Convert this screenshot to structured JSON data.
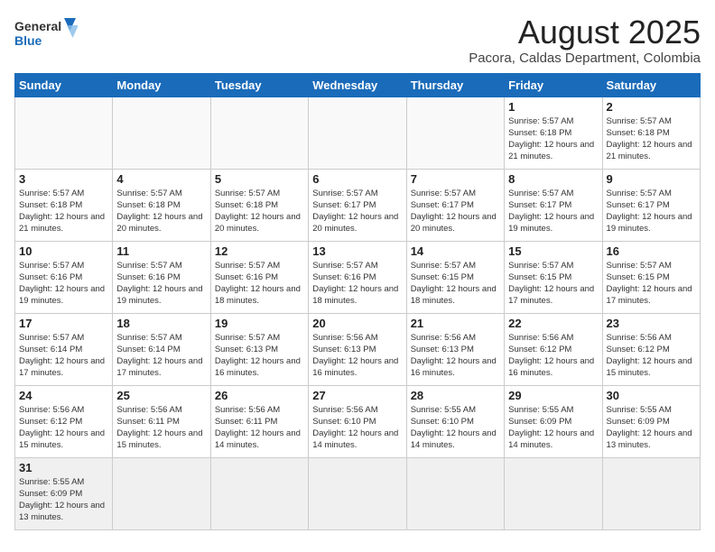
{
  "header": {
    "logo_general": "General",
    "logo_blue": "Blue",
    "title": "August 2025",
    "subtitle": "Pacora, Caldas Department, Colombia"
  },
  "weekdays": [
    "Sunday",
    "Monday",
    "Tuesday",
    "Wednesday",
    "Thursday",
    "Friday",
    "Saturday"
  ],
  "weeks": [
    [
      {
        "day": "",
        "info": ""
      },
      {
        "day": "",
        "info": ""
      },
      {
        "day": "",
        "info": ""
      },
      {
        "day": "",
        "info": ""
      },
      {
        "day": "",
        "info": ""
      },
      {
        "day": "1",
        "info": "Sunrise: 5:57 AM\nSunset: 6:18 PM\nDaylight: 12 hours\nand 21 minutes."
      },
      {
        "day": "2",
        "info": "Sunrise: 5:57 AM\nSunset: 6:18 PM\nDaylight: 12 hours\nand 21 minutes."
      }
    ],
    [
      {
        "day": "3",
        "info": "Sunrise: 5:57 AM\nSunset: 6:18 PM\nDaylight: 12 hours\nand 21 minutes."
      },
      {
        "day": "4",
        "info": "Sunrise: 5:57 AM\nSunset: 6:18 PM\nDaylight: 12 hours\nand 20 minutes."
      },
      {
        "day": "5",
        "info": "Sunrise: 5:57 AM\nSunset: 6:18 PM\nDaylight: 12 hours\nand 20 minutes."
      },
      {
        "day": "6",
        "info": "Sunrise: 5:57 AM\nSunset: 6:17 PM\nDaylight: 12 hours\nand 20 minutes."
      },
      {
        "day": "7",
        "info": "Sunrise: 5:57 AM\nSunset: 6:17 PM\nDaylight: 12 hours\nand 20 minutes."
      },
      {
        "day": "8",
        "info": "Sunrise: 5:57 AM\nSunset: 6:17 PM\nDaylight: 12 hours\nand 19 minutes."
      },
      {
        "day": "9",
        "info": "Sunrise: 5:57 AM\nSunset: 6:17 PM\nDaylight: 12 hours\nand 19 minutes."
      }
    ],
    [
      {
        "day": "10",
        "info": "Sunrise: 5:57 AM\nSunset: 6:16 PM\nDaylight: 12 hours\nand 19 minutes."
      },
      {
        "day": "11",
        "info": "Sunrise: 5:57 AM\nSunset: 6:16 PM\nDaylight: 12 hours\nand 19 minutes."
      },
      {
        "day": "12",
        "info": "Sunrise: 5:57 AM\nSunset: 6:16 PM\nDaylight: 12 hours\nand 18 minutes."
      },
      {
        "day": "13",
        "info": "Sunrise: 5:57 AM\nSunset: 6:16 PM\nDaylight: 12 hours\nand 18 minutes."
      },
      {
        "day": "14",
        "info": "Sunrise: 5:57 AM\nSunset: 6:15 PM\nDaylight: 12 hours\nand 18 minutes."
      },
      {
        "day": "15",
        "info": "Sunrise: 5:57 AM\nSunset: 6:15 PM\nDaylight: 12 hours\nand 17 minutes."
      },
      {
        "day": "16",
        "info": "Sunrise: 5:57 AM\nSunset: 6:15 PM\nDaylight: 12 hours\nand 17 minutes."
      }
    ],
    [
      {
        "day": "17",
        "info": "Sunrise: 5:57 AM\nSunset: 6:14 PM\nDaylight: 12 hours\nand 17 minutes."
      },
      {
        "day": "18",
        "info": "Sunrise: 5:57 AM\nSunset: 6:14 PM\nDaylight: 12 hours\nand 17 minutes."
      },
      {
        "day": "19",
        "info": "Sunrise: 5:57 AM\nSunset: 6:13 PM\nDaylight: 12 hours\nand 16 minutes."
      },
      {
        "day": "20",
        "info": "Sunrise: 5:56 AM\nSunset: 6:13 PM\nDaylight: 12 hours\nand 16 minutes."
      },
      {
        "day": "21",
        "info": "Sunrise: 5:56 AM\nSunset: 6:13 PM\nDaylight: 12 hours\nand 16 minutes."
      },
      {
        "day": "22",
        "info": "Sunrise: 5:56 AM\nSunset: 6:12 PM\nDaylight: 12 hours\nand 16 minutes."
      },
      {
        "day": "23",
        "info": "Sunrise: 5:56 AM\nSunset: 6:12 PM\nDaylight: 12 hours\nand 15 minutes."
      }
    ],
    [
      {
        "day": "24",
        "info": "Sunrise: 5:56 AM\nSunset: 6:12 PM\nDaylight: 12 hours\nand 15 minutes."
      },
      {
        "day": "25",
        "info": "Sunrise: 5:56 AM\nSunset: 6:11 PM\nDaylight: 12 hours\nand 15 minutes."
      },
      {
        "day": "26",
        "info": "Sunrise: 5:56 AM\nSunset: 6:11 PM\nDaylight: 12 hours\nand 14 minutes."
      },
      {
        "day": "27",
        "info": "Sunrise: 5:56 AM\nSunset: 6:10 PM\nDaylight: 12 hours\nand 14 minutes."
      },
      {
        "day": "28",
        "info": "Sunrise: 5:55 AM\nSunset: 6:10 PM\nDaylight: 12 hours\nand 14 minutes."
      },
      {
        "day": "29",
        "info": "Sunrise: 5:55 AM\nSunset: 6:09 PM\nDaylight: 12 hours\nand 14 minutes."
      },
      {
        "day": "30",
        "info": "Sunrise: 5:55 AM\nSunset: 6:09 PM\nDaylight: 12 hours\nand 13 minutes."
      }
    ],
    [
      {
        "day": "31",
        "info": "Sunrise: 5:55 AM\nSunset: 6:09 PM\nDaylight: 12 hours\nand 13 minutes."
      },
      {
        "day": "",
        "info": ""
      },
      {
        "day": "",
        "info": ""
      },
      {
        "day": "",
        "info": ""
      },
      {
        "day": "",
        "info": ""
      },
      {
        "day": "",
        "info": ""
      },
      {
        "day": "",
        "info": ""
      }
    ]
  ]
}
